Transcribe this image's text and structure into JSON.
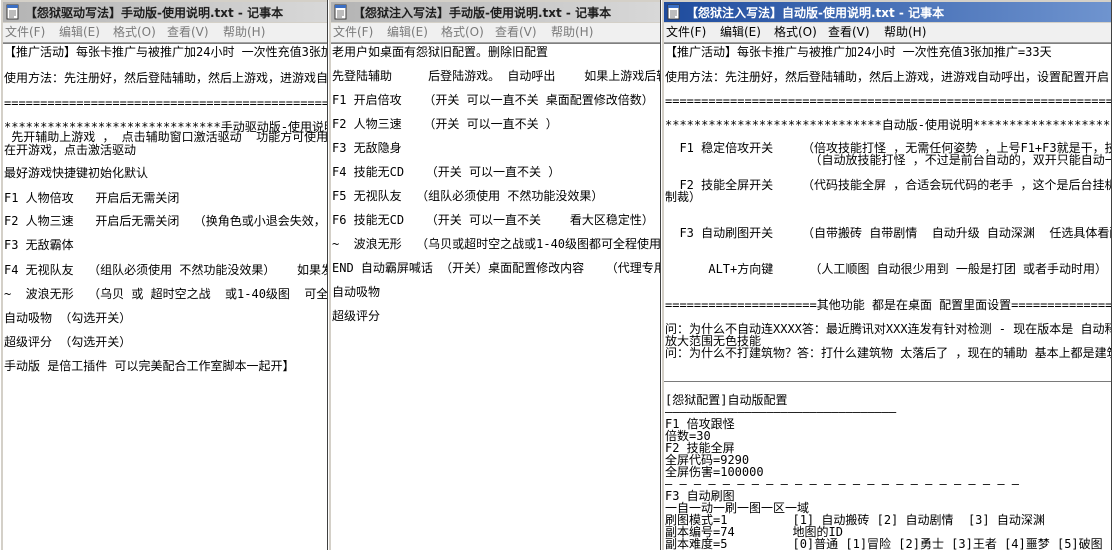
{
  "colors": {
    "active_title_from": "#1f4c9e",
    "active_title_to": "#6f94cf",
    "inactive_title_from": "#b4b4b4",
    "inactive_title_to": "#d8d8d8",
    "inactive_menu_text": "#7a7a7a"
  },
  "windows": [
    {
      "active": false,
      "icon": "notepad-icon",
      "title": "【怨狱驱动写法】手动版-使用说明.txt - 记事本",
      "menu": [
        "文件(F)",
        "编辑(E)",
        "格式(O)",
        "查看(V)",
        "帮助(H)"
      ],
      "lines": [
        "【推广活动】每张卡推广与被推广加24小时 一次性充值3张加",
        "使用方法：先注册好，然后登陆辅助，然后上游戏，进游戏自",
        "======================================================",
        "******************************手动驱动版-使用说明****",
        " 先开辅助上游戏 ， 点击辅助窗口激活驱动  功能方可使用",
        "在开游戏，点击激活驱动",
        "最好游戏快捷键初始化默认",
        "F1 人物倍攻   开启后无需关闭",
        "F2 人物三速   开启后无需关闭  （换角色或小退会失效，",
        "F3 无敌霸体",
        "F4 无视队友  （组队必须使用 不然功能没效果）   如果发现",
        "~  波浪无形  （乌贝 或 超时空之战  或1-40级图  可全程",
        "自动吸物 （勾选开关）",
        "超级评分 （勾选开关）",
        "手动版 是倍工插件 可以完美配合工作室脚本一起开】"
      ]
    },
    {
      "active": false,
      "icon": "notepad-icon",
      "title": "【怨狱注入写法】手动版-使用说明.txt - 记事本",
      "menu": [
        "文件(F)",
        "编辑(E)",
        "格式(O)",
        "查看(V)",
        "帮助(H)"
      ],
      "lines": [
        "老用户如桌面有怨狱旧配置。删除旧配置",
        "先登陆辅助     后登陆游戏。 自动呼出    如果上游戏后辅助",
        "F1 开启倍攻   （开关 可以一直不关 桌面配置修改倍数）",
        "F2 人物三速   （开关 可以一直不关 ）",
        "F3 无敌隐身",
        "F4 技能无CD   （开关 可以一直不关 ）",
        "F5 无视队友  （组队必须使用 不然功能没效果）",
        "F6 技能无CD   （开关 可以一直不关    看大区稳定性）",
        "~  波浪无形  （乌贝或超时空之战或1-40级图都可全程使用）",
        "END 自动霸屏喊话 （开关）桌面配置修改内容   （代理专用",
        "自动吸物",
        "超级评分"
      ]
    },
    {
      "active": true,
      "icon": "notepad-icon",
      "title": "【怨狱注入写法】自动版-使用说明.txt - 记事本",
      "menu": [
        "文件(F)",
        "编辑(E)",
        "格式(O)",
        "查看(V)",
        "帮助(H)"
      ],
      "lines": [
        "【推广活动】每张卡推广与被推广加24小时 一次性充值3张加推广=33天",
        "使用方法：先注册好，然后登陆辅助，然后上游戏，进游戏自动呼出，设置配置开启",
        "===========================================================================",
        "******************************自动版-使用说明******************************",
        "  F1 稳定倍攻开关    （倍攻技能打怪 ，无需任何姿势 ，上号F1+F3就是干，技能打",
        "                    （自动放技能打怪 ，不过是前台自动的，双开只能自动一个）",
        "  F2 技能全屏开关    （代码技能全屏 ，合适会玩代码的老手 ，这个是后台挂机的",
        "制裁）",
        "  F3 自动刷图开关    （自带搬砖 自带剧情  自动升级 自动深渊  任选具体看配置",
        "      ALT+方向键     （人工顺图 自动很少用到 一般是打团 或者手动时用）",
        "=====================其他功能 都是在桌面 配置里面设置=====================",
        "问：为什么不自动连XXXX答：最近腾讯对XXX连发有针对检测 - 现在版本是 自动释放",
        "放大范围无色技能",
        "问：为什么不打建筑物？答：打什么建筑物 太落后了 ，现在的辅助 基本上都是建筑",
        "[怨狱配置]自动版配置",
        "————————————————————————————————",
        "F1 倍攻跟怪",
        "倍数=30",
        "F2 技能全屏",
        "全屏代码=9290",
        "全屏伤害=100000",
        "— — — — — — — — — — — — — — — — — — — — — — — — —",
        "F3 自动刷图",
        "一自一动一刷一图一区一域",
        "刷图模式=1         [1] 自动搬砖 [2] 自动剧情  [3] 自动深渊",
        "副本编号=74        地图的ID",
        "副本难度=5         [0]普通 [1]冒险 [2]勇士 [3]王者 [4]噩梦 [5]破图"
      ]
    }
  ]
}
